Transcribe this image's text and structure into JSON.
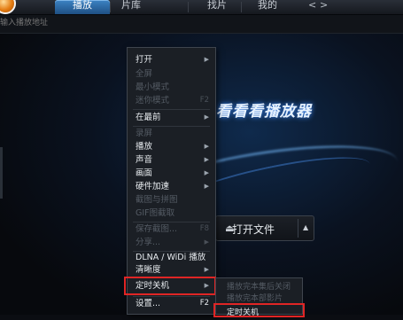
{
  "tabs": [
    {
      "label": "播放"
    },
    {
      "label": "片库"
    },
    {
      "label": "找片"
    },
    {
      "label": "我的"
    }
  ],
  "nav": {
    "back": "<",
    "forward": ">"
  },
  "address": {
    "placeholder": "输入播放地址"
  },
  "brand": {
    "text": "看看看播放器"
  },
  "open_button": {
    "label": "打开文件",
    "icon": "eject-icon"
  },
  "menu": {
    "items": [
      {
        "label": "打开",
        "enabled": true,
        "submenu": true
      },
      {
        "label": "全屏",
        "enabled": false
      },
      {
        "label": "最小模式",
        "enabled": false
      },
      {
        "label": "迷你模式",
        "enabled": false,
        "shortcut": "F2"
      },
      {
        "label": "在最前",
        "enabled": true,
        "submenu": true
      },
      {
        "label": "录屏",
        "enabled": false
      },
      {
        "label": "播放",
        "enabled": true,
        "submenu": true
      },
      {
        "label": "声音",
        "enabled": true,
        "submenu": true
      },
      {
        "label": "画面",
        "enabled": true,
        "submenu": true
      },
      {
        "label": "硬件加速",
        "enabled": true,
        "submenu": true
      },
      {
        "label": "截图与拼图",
        "enabled": false
      },
      {
        "label": "GIF图截取",
        "enabled": false
      },
      {
        "label": "保存截图...",
        "enabled": false,
        "shortcut": "F8"
      },
      {
        "label": "分享...",
        "enabled": false,
        "submenu": true
      },
      {
        "label": "DLNA / WiDi 播放",
        "enabled": true
      },
      {
        "label": "清晰度",
        "enabled": true,
        "submenu": true
      },
      {
        "label": "定时关机",
        "enabled": true,
        "submenu": true,
        "highlighted": true
      },
      {
        "label": "设置...",
        "enabled": true,
        "shortcut": "F2"
      }
    ]
  },
  "submenu": {
    "items": [
      {
        "label": "播放完本集后关闭",
        "enabled": false
      },
      {
        "label": "播放完本部影片",
        "enabled": false
      },
      {
        "label": "定时关机",
        "enabled": true,
        "highlighted": true
      }
    ]
  },
  "colors": {
    "accent": "#2e6aa8",
    "highlight": "#e02525"
  }
}
